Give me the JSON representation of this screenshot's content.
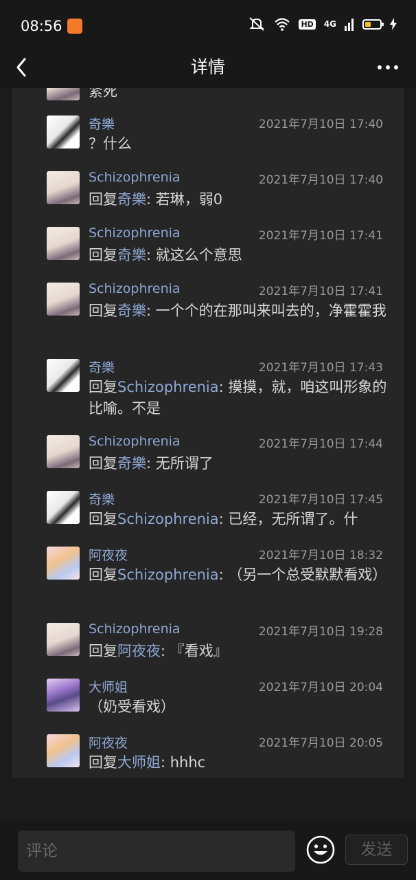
{
  "status_bar": {
    "time": "08:56",
    "hd": "HD",
    "network": "4G",
    "battery_level": 0.4
  },
  "nav": {
    "title": "详情"
  },
  "partial_top": {
    "text": "紧死"
  },
  "replies": [
    {
      "name": "奇樂",
      "time": "2021年7月10日 17:40",
      "prefix": "",
      "mention": "",
      "text": "？什么"
    },
    {
      "name": "Schizophrenia",
      "time": "2021年7月10日 17:40",
      "prefix": "回复",
      "mention": "奇樂",
      "text": ": 若琳，弱0"
    },
    {
      "name": "Schizophrenia",
      "time": "2021年7月10日 17:41",
      "prefix": "回复",
      "mention": "奇樂",
      "text": ": 就这么个意思"
    },
    {
      "name": "Schizophrenia",
      "time": "2021年7月10日 17:41",
      "prefix": "回复",
      "mention": "奇樂",
      "text": ": 一个个的在那叫来叫去的，净霍霍我"
    },
    {
      "name": "奇樂",
      "time": "2021年7月10日 17:43",
      "prefix": "回复",
      "mention": "Schizophrenia",
      "text": ": 摸摸，就，咱这叫形象的比喻。不是"
    },
    {
      "name": "Schizophrenia",
      "time": "2021年7月10日 17:44",
      "prefix": "回复",
      "mention": "奇樂",
      "text": ": 无所谓了"
    },
    {
      "name": "奇樂",
      "time": "2021年7月10日 17:45",
      "prefix": "回复",
      "mention": "Schizophrenia",
      "text": ": 已经，无所谓了。什"
    },
    {
      "name": "阿夜夜",
      "time": "2021年7月10日 18:32",
      "prefix": "回复",
      "mention": "Schizophrenia",
      "text": ": （另一个总受默默看戏）"
    },
    {
      "name": "Schizophrenia",
      "time": "2021年7月10日 19:28",
      "prefix": "回复",
      "mention": "阿夜夜",
      "text": ": 『看戏』"
    },
    {
      "name": "大师姐",
      "time": "2021年7月10日 20:04",
      "prefix": "",
      "mention": "",
      "text": "（奶受看戏）"
    },
    {
      "name": "阿夜夜",
      "time": "2021年7月10日 20:05",
      "prefix": "回复",
      "mention": "大师姐",
      "text": ": hhhc"
    }
  ],
  "composer": {
    "placeholder": "评论",
    "send_label": "发送"
  },
  "colors": {
    "mention": "#8fa7d3",
    "background": "#1c1c1c",
    "card": "#262626"
  }
}
